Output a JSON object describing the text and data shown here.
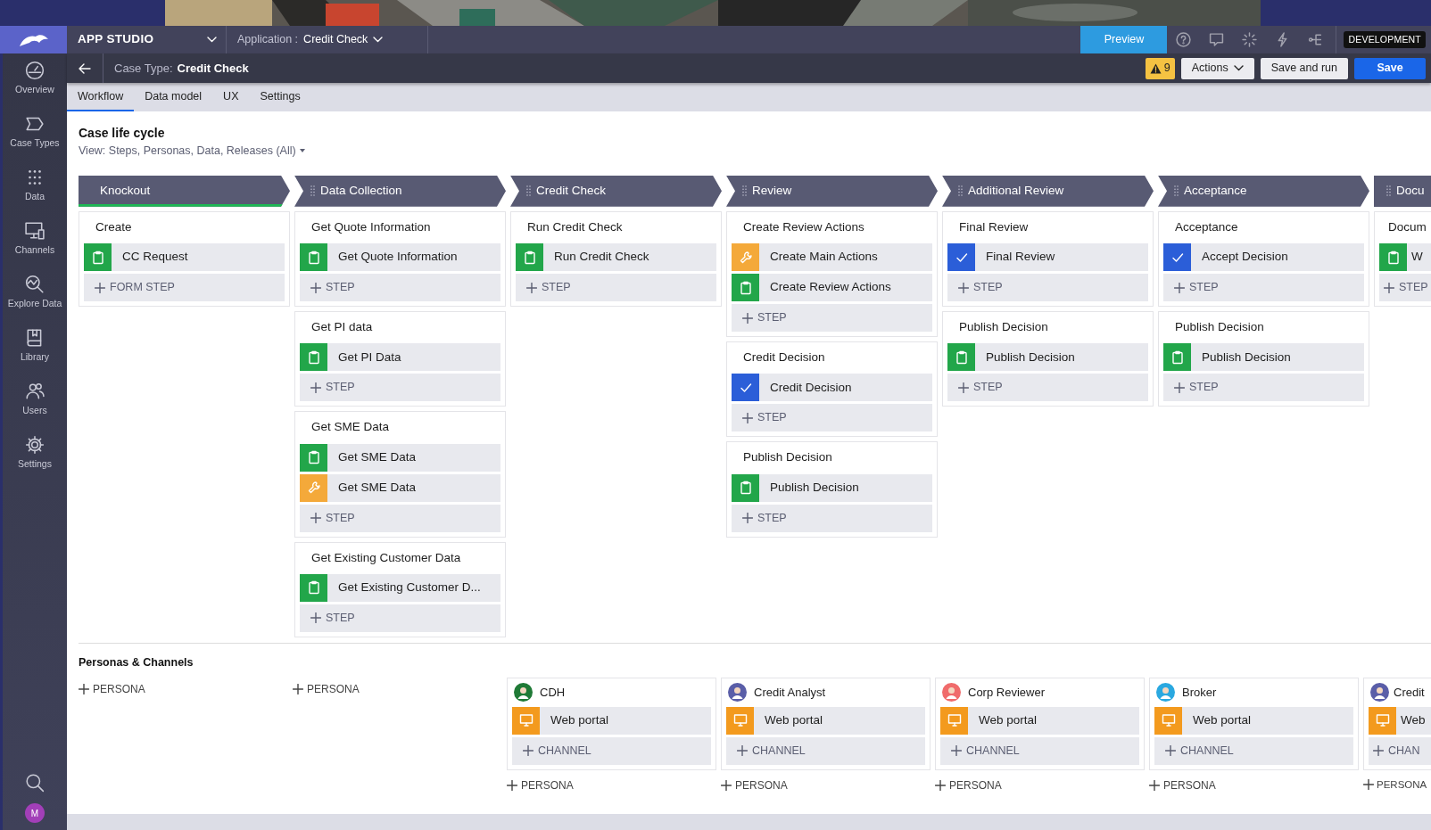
{
  "header": {
    "app_name": "APP STUDIO",
    "application_label": "Application :",
    "application_value": "Credit Check",
    "preview": "Preview",
    "environment": "DEVELOPMENT"
  },
  "case_bar": {
    "label": "Case Type:",
    "value": "Credit Check",
    "warnings": "9",
    "actions": "Actions",
    "save_and_run": "Save and run",
    "save": "Save"
  },
  "sidebar": {
    "items": [
      {
        "label": "Overview"
      },
      {
        "label": "Case Types"
      },
      {
        "label": "Data"
      },
      {
        "label": "Channels"
      },
      {
        "label": "Explore Data"
      },
      {
        "label": "Library"
      },
      {
        "label": "Users"
      },
      {
        "label": "Settings"
      }
    ],
    "avatar": "M"
  },
  "tabs": [
    {
      "label": "Workflow",
      "selected": true
    },
    {
      "label": "Data model",
      "selected": false
    },
    {
      "label": "UX",
      "selected": false
    },
    {
      "label": "Settings",
      "selected": false
    }
  ],
  "lifecycle": {
    "title": "Case life cycle",
    "view": "View: Steps, Personas, Data, Releases (All)",
    "stages": [
      {
        "name": "Knockout",
        "active": true,
        "groups": [
          {
            "title": "Create",
            "steps": [
              {
                "label": "CC Request",
                "kind": "form"
              }
            ],
            "add": "FORM STEP"
          }
        ]
      },
      {
        "name": "Data Collection",
        "active": false,
        "groups": [
          {
            "title": "Get Quote Information",
            "steps": [
              {
                "label": "Get Quote Information",
                "kind": "form"
              }
            ],
            "add": "STEP"
          },
          {
            "title": "Get PI data",
            "steps": [
              {
                "label": "Get PI Data",
                "kind": "form"
              }
            ],
            "add": "STEP"
          },
          {
            "title": "Get SME Data",
            "steps": [
              {
                "label": "Get SME Data",
                "kind": "form"
              },
              {
                "label": "Get SME Data",
                "kind": "automation"
              }
            ],
            "add": "STEP"
          },
          {
            "title": "Get Existing Customer Data",
            "steps": [
              {
                "label": "Get Existing Customer D...",
                "kind": "form"
              }
            ],
            "add": "STEP"
          }
        ]
      },
      {
        "name": "Credit Check",
        "active": false,
        "groups": [
          {
            "title": "Run Credit Check",
            "steps": [
              {
                "label": "Run Credit Check",
                "kind": "form"
              }
            ],
            "add": "STEP"
          }
        ]
      },
      {
        "name": "Review",
        "active": false,
        "groups": [
          {
            "title": "Create Review Actions",
            "steps": [
              {
                "label": "Create Main Actions",
                "kind": "automation"
              },
              {
                "label": "Create Review Actions",
                "kind": "form"
              }
            ],
            "add": "STEP"
          },
          {
            "title": "Credit Decision",
            "steps": [
              {
                "label": "Credit Decision",
                "kind": "approval"
              }
            ],
            "add": "STEP"
          },
          {
            "title": "Publish Decision",
            "steps": [
              {
                "label": "Publish Decision",
                "kind": "form"
              }
            ],
            "add": "STEP"
          }
        ]
      },
      {
        "name": "Additional Review",
        "active": false,
        "groups": [
          {
            "title": "Final Review",
            "steps": [
              {
                "label": "Final Review",
                "kind": "approval"
              }
            ],
            "add": "STEP"
          },
          {
            "title": "Publish Decision",
            "steps": [
              {
                "label": "Publish Decision",
                "kind": "form"
              }
            ],
            "add": "STEP"
          }
        ]
      },
      {
        "name": "Acceptance",
        "active": false,
        "groups": [
          {
            "title": "Acceptance",
            "steps": [
              {
                "label": "Accept Decision",
                "kind": "approval"
              }
            ],
            "add": "STEP"
          },
          {
            "title": "Publish Decision",
            "steps": [
              {
                "label": "Publish Decision",
                "kind": "form"
              }
            ],
            "add": "STEP"
          }
        ]
      },
      {
        "name": "Docu",
        "active": false,
        "groups": [
          {
            "title": "Docum",
            "steps": [
              {
                "label": "W",
                "kind": "form"
              }
            ],
            "add": "STEP"
          }
        ]
      }
    ]
  },
  "personas": {
    "title": "Personas & Channels",
    "columns": [
      {
        "add": "PERSONA"
      },
      {
        "add": "PERSONA"
      },
      {
        "persona": {
          "name": "CDH",
          "color": "#1f7a36",
          "channels": [
            {
              "label": "Web portal"
            }
          ],
          "add_channel": "CHANNEL"
        },
        "add": "PERSONA"
      },
      {
        "persona": {
          "name": "Credit Analyst",
          "color": "#5a5ea8",
          "channels": [
            {
              "label": "Web portal"
            }
          ],
          "add_channel": "CHANNEL"
        },
        "add": "PERSONA"
      },
      {
        "persona": {
          "name": "Corp Reviewer",
          "color": "#f06b6b",
          "channels": [
            {
              "label": "Web portal"
            }
          ],
          "add_channel": "CHANNEL"
        },
        "add": "PERSONA"
      },
      {
        "persona": {
          "name": "Broker",
          "color": "#2aa8e0",
          "channels": [
            {
              "label": "Web portal"
            }
          ],
          "add_channel": "CHANNEL"
        },
        "add": "PERSONA"
      },
      {
        "persona": {
          "name": "Credit",
          "color": "#5a5ea8",
          "channels": [
            {
              "label": "Web"
            }
          ],
          "add_channel": "CHAN"
        },
        "add": "PERSONA"
      }
    ]
  }
}
